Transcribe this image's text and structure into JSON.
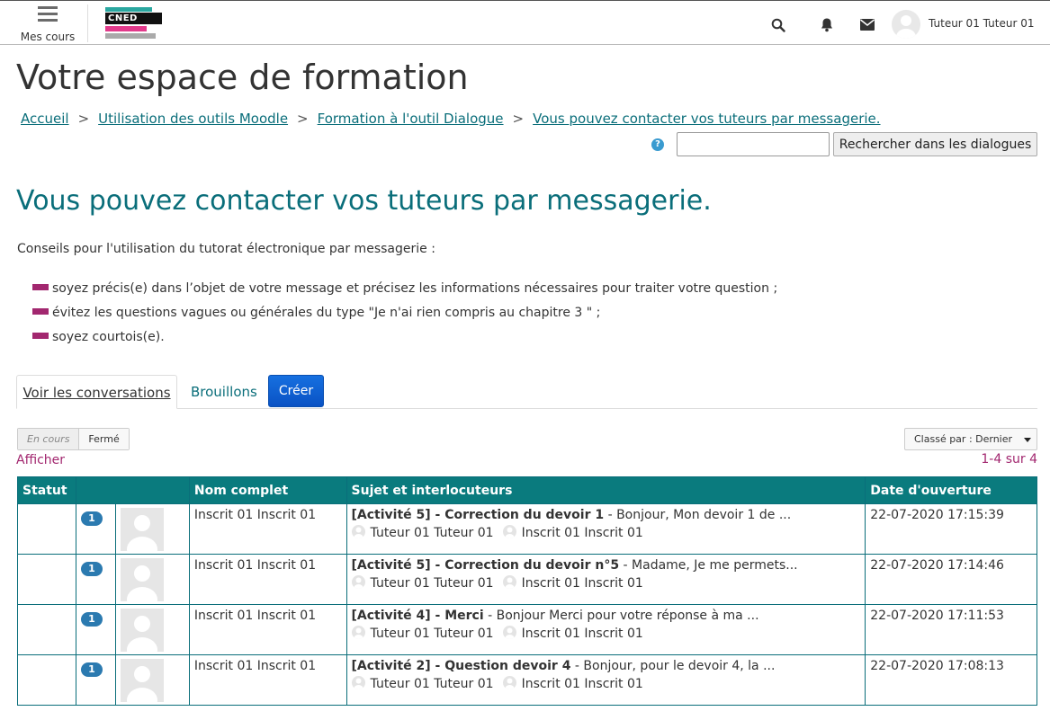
{
  "nav": {
    "menu_label": "Mes cours",
    "logo_text": "CNED",
    "user_name": "Tuteur 01 Tuteur 01"
  },
  "page": {
    "title": "Votre espace de formation",
    "breadcrumb": [
      "Accueil",
      "Utilisation des outils Moodle",
      "Formation à l'outil Dialogue",
      "Vous pouvez contacter vos tuteurs par messagerie."
    ],
    "search_button": "Rechercher dans les dialogues",
    "search_value": ""
  },
  "content": {
    "heading": "Vous pouvez contacter vos tuteurs par messagerie.",
    "intro": "Conseils pour l'utilisation du tutorat électronique par messagerie :",
    "tips": [
      "soyez précis(e) dans l’objet de votre message et précisez les informations nécessaires pour traiter votre question ;",
      "évitez les questions vagues ou générales du type \"Je n'ai rien compris au chapitre 3 \" ;",
      "soyez courtois(e)."
    ]
  },
  "tabs": {
    "conversations": "Voir les conversations",
    "drafts": "Brouillons",
    "create": "Créer"
  },
  "filters": {
    "open": "En cours",
    "closed": "Fermé",
    "show": "Afficher",
    "sort": "Classé par : Dernier",
    "count": "1-4 sur 4"
  },
  "table": {
    "headers": [
      "Statut",
      "",
      "Nom complet",
      "Sujet et interlocuteurs",
      "Date d'ouverture"
    ],
    "rows": [
      {
        "badge": "1",
        "name": "Inscrit 01 Inscrit 01",
        "subject": "[Activité 5] - Correction du devoir 1",
        "snippet": " - Bonjour, Mon devoir 1 de ...",
        "p1": "Tuteur 01 Tuteur 01",
        "p2": "Inscrit 01 Inscrit 01",
        "date": "22-07-2020 17:15:39"
      },
      {
        "badge": "1",
        "name": "Inscrit 01 Inscrit 01",
        "subject": "[Activité 5] - Correction du devoir n°5",
        "snippet": " - Madame,  Je me permets...",
        "p1": "Tuteur 01 Tuteur 01",
        "p2": "Inscrit 01 Inscrit 01",
        "date": "22-07-2020 17:14:46"
      },
      {
        "badge": "1",
        "name": "Inscrit 01 Inscrit 01",
        "subject": "[Activité 4] - Merci",
        "snippet": " - Bonjour  Merci pour votre réponse à ma ...",
        "p1": "Tuteur 01 Tuteur 01",
        "p2": "Inscrit 01 Inscrit 01",
        "date": "22-07-2020 17:11:53"
      },
      {
        "badge": "1",
        "name": "Inscrit 01 Inscrit 01",
        "subject": "[Activité 2] - Question devoir 4",
        "snippet": " - Bonjour, pour le devoir 4, la ...",
        "p1": "Tuteur 01 Tuteur 01",
        "p2": "Inscrit 01 Inscrit 01",
        "date": "22-07-2020 17:08:13"
      }
    ]
  },
  "colors": {
    "teal": "#0a7b7e",
    "magenta": "#a2276f",
    "create_blue": "#0a52c4"
  },
  "icons": [
    "menu-icon",
    "search-icon",
    "bell-icon",
    "envelope-icon",
    "user-avatar-icon",
    "help-icon",
    "caret-down-icon"
  ]
}
